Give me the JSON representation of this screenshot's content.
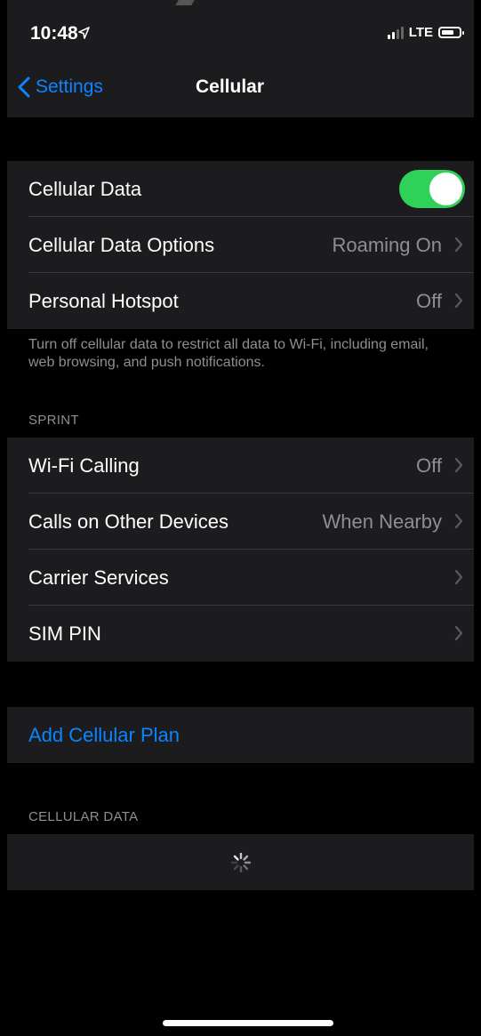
{
  "status": {
    "time": "10:48",
    "network": "LTE"
  },
  "nav": {
    "back_label": "Settings",
    "title": "Cellular"
  },
  "group1": {
    "cellular_data": {
      "label": "Cellular Data",
      "on": true
    },
    "options": {
      "label": "Cellular Data Options",
      "value": "Roaming On"
    },
    "hotspot": {
      "label": "Personal Hotspot",
      "value": "Off"
    }
  },
  "footnote": "Turn off cellular data to restrict all data to Wi-Fi, including email, web browsing, and push notifications.",
  "sprint": {
    "header": "SPRINT",
    "rows": [
      {
        "label": "Wi-Fi Calling",
        "value": "Off"
      },
      {
        "label": "Calls on Other Devices",
        "value": "When Nearby"
      },
      {
        "label": "Carrier Services",
        "value": ""
      },
      {
        "label": "SIM PIN",
        "value": ""
      }
    ]
  },
  "add_plan": "Add Cellular Plan",
  "cellular_data_header": "CELLULAR DATA",
  "colors": {
    "accent": "#0a84ff",
    "toggle_on": "#30d158",
    "group_bg": "#1c1c1e"
  }
}
